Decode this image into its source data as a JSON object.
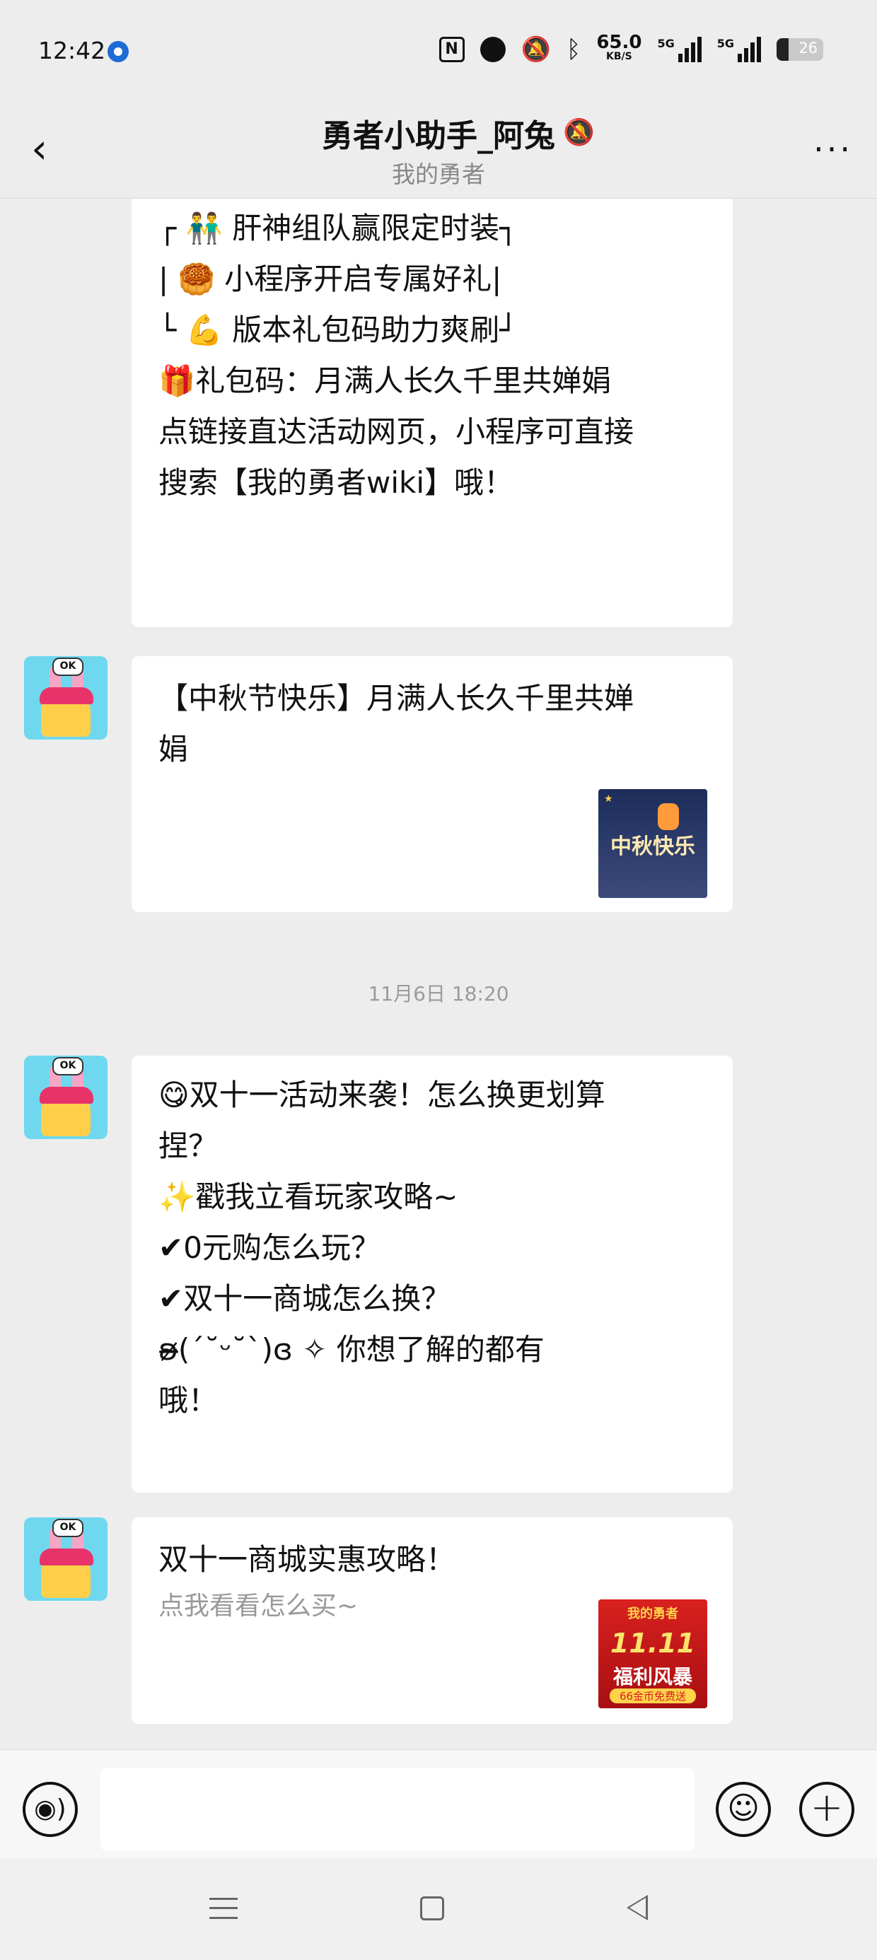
{
  "status_bar": {
    "time": "12:42",
    "speed_value": "65.0",
    "speed_unit": "KB/S",
    "signal1_label": "5G",
    "signal2_label": "5G",
    "battery_level": "26",
    "battery_fraction": 0.26
  },
  "header": {
    "title": "勇者小助手_阿兔",
    "subtitle": "我的勇者"
  },
  "messages": [
    {
      "lines": [
        "┌ 👬 肝神组队赢限定时装┐",
        "| 🥮 小程序开启专属好礼|",
        "└ 💪 版本礼包码助力爽刷┘",
        "",
        "🎁礼包码：月满人长久千里共婵娟",
        "",
        "点链接直达活动网页，小程序可直接",
        "搜索【我的勇者wiki】哦！"
      ]
    },
    {
      "lines": [
        "【中秋节快乐】月满人长久千里共婵",
        "娟"
      ],
      "thumb_text": "中秋快乐"
    },
    {
      "lines": [
        "😋双十一活动来袭！怎么换更划算",
        "捏？",
        "✨戳我立看玩家攻略~",
        "✔0元购怎么玩？",
        "✔双十一商城怎么换？",
        "",
        "ʚ̴̶̷(ˊ˘ᵕ˘ˋ)ɞ ✧ 你想了解的都有",
        "哦！"
      ]
    },
    {
      "title": "双十一商城实惠攻略！",
      "subtitle": "点我看看怎么买~",
      "thumb_top": "我的勇者",
      "thumb_big": "11.11",
      "thumb_mid": "福利风暴",
      "thumb_small": "66金币免费送"
    }
  ],
  "timestamp": "11月6日  18:20",
  "input_bar": {
    "placeholder": ""
  }
}
